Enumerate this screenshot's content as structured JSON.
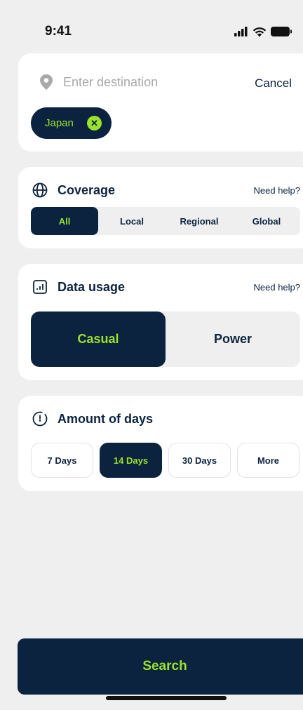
{
  "status_bar": {
    "time": "9:41"
  },
  "destination": {
    "placeholder": "Enter destination",
    "cancel_label": "Cancel",
    "selected_chip": "Japan"
  },
  "coverage": {
    "title": "Coverage",
    "help": "Need help?",
    "options": [
      "All",
      "Local",
      "Regional",
      "Global"
    ],
    "selected": "All"
  },
  "data_usage": {
    "title": "Data usage",
    "help": "Need help?",
    "options": [
      "Casual",
      "Power"
    ],
    "selected": "Casual"
  },
  "days": {
    "title": "Amount of days",
    "options": [
      "7 Days",
      "14 Days",
      "30 Days",
      "More"
    ],
    "selected": "14 Days"
  },
  "search_label": "Search",
  "colors": {
    "navy": "#0c2340",
    "accent": "#9be22a",
    "background": "#efefef"
  }
}
